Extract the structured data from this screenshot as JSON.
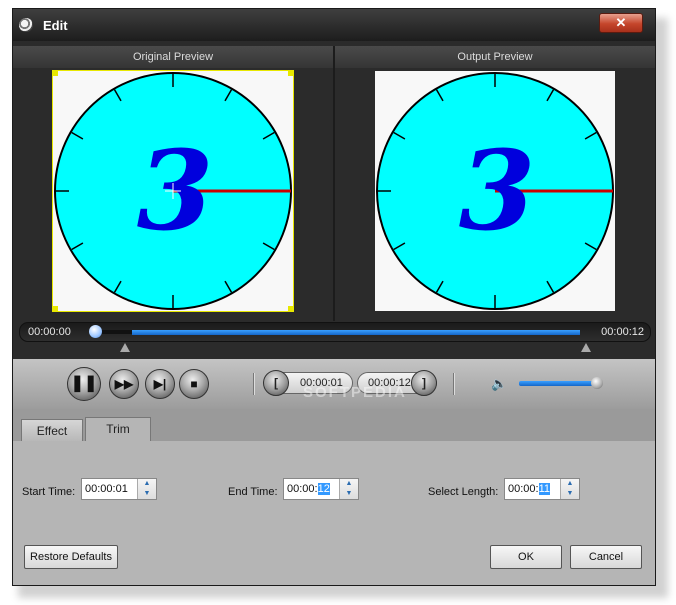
{
  "window": {
    "title": "Edit",
    "close_label": "✕"
  },
  "preview": {
    "original_label": "Original Preview",
    "output_label": "Output Preview",
    "digit": "3",
    "start_time": "00:00:00",
    "end_time": "00:00:12",
    "scrub_progress": 0.0
  },
  "controls": {
    "pause_label": "❚❚",
    "ff_label": "▶▶",
    "next_label": "▶|",
    "stop_label": "■",
    "mark_in_time": "00:00:01",
    "mark_out_time": "00:00:12",
    "mark_in_icon": "[",
    "mark_out_icon": "]",
    "volume_level": 0.9,
    "volume_icon": "🔈"
  },
  "watermark": "SOFTPEDIA",
  "tabs": [
    {
      "label": "Effect",
      "active": false
    },
    {
      "label": "Trim",
      "active": true
    }
  ],
  "trim": {
    "start_label": "Start Time:",
    "start_value": "00:00:01",
    "end_label": "End Time:",
    "end_value_prefix": "00:00:",
    "end_value_hl": "12",
    "length_label": "Select Length:",
    "length_value_prefix": "00:00:",
    "length_value_hl": "11"
  },
  "buttons": {
    "restore": "Restore Defaults",
    "ok": "OK",
    "cancel": "Cancel"
  },
  "colors": {
    "dial": "#00ffff",
    "digit": "#0000dd",
    "hand": "#cc0000",
    "accent": "#1466c8"
  }
}
